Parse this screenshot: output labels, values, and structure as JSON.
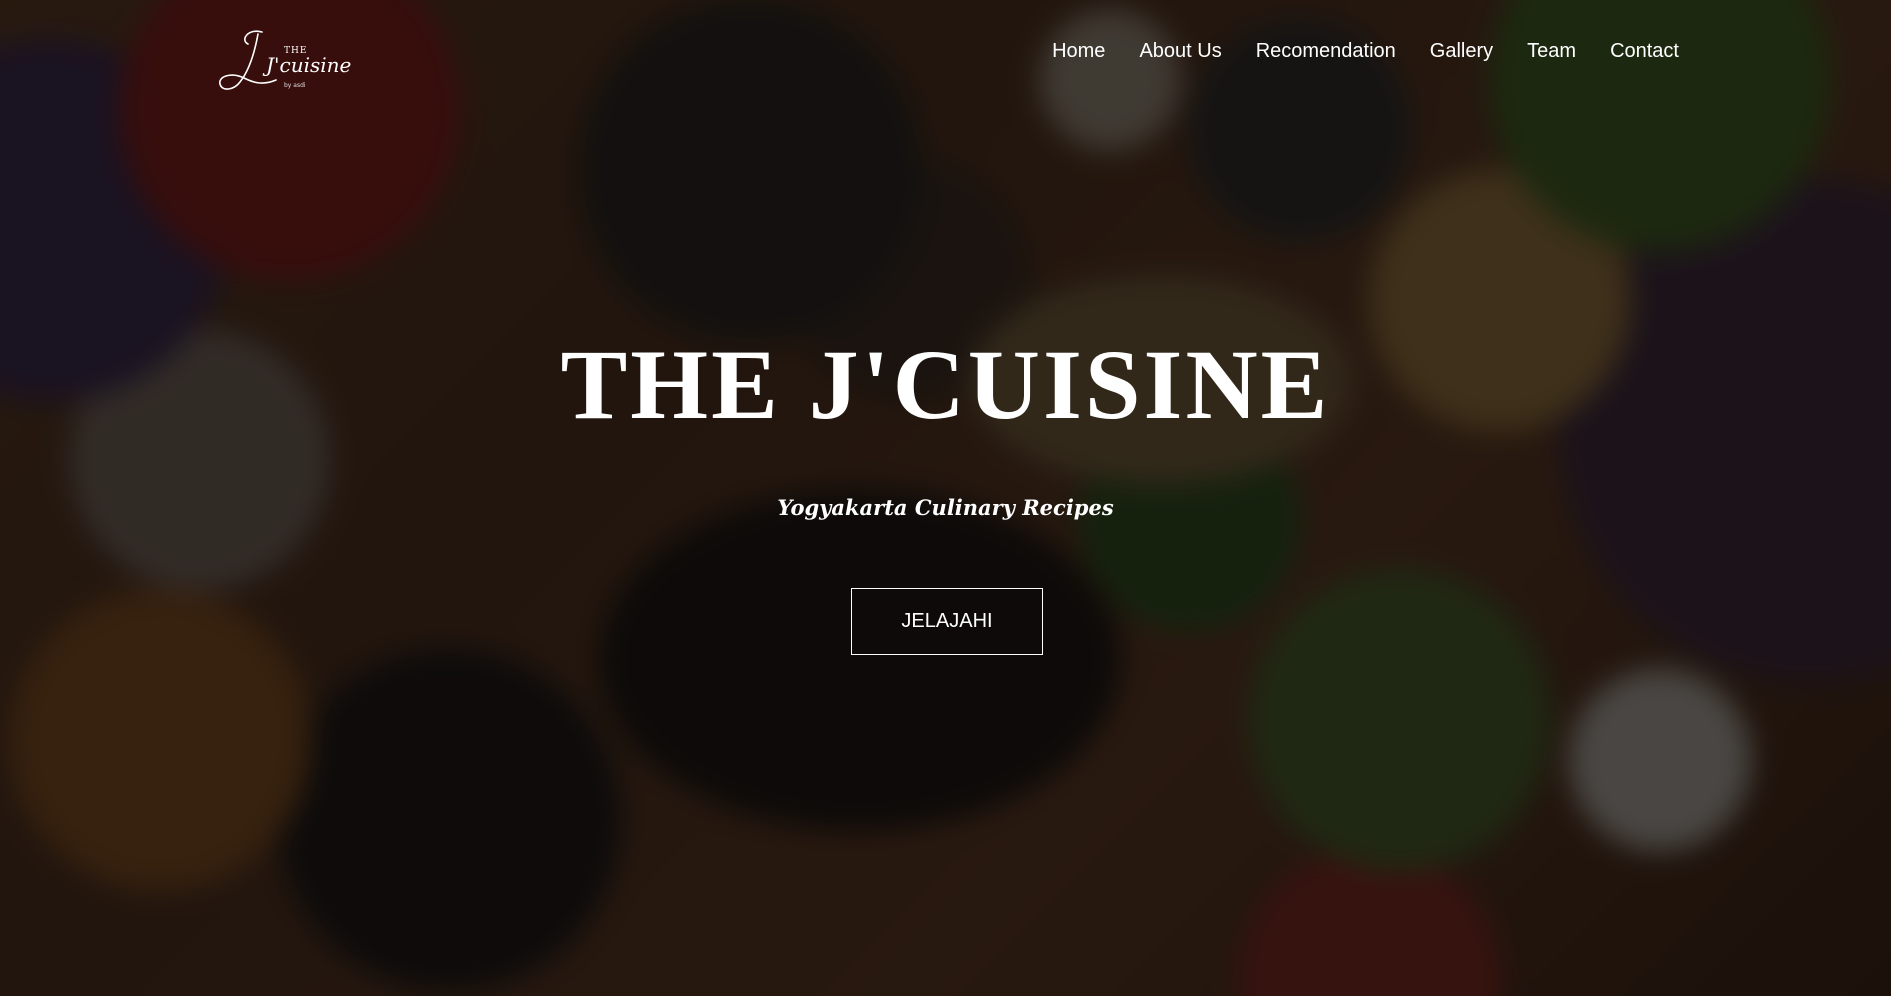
{
  "header": {
    "logo": {
      "the": "THE",
      "wordmark": "J'cuisine",
      "byline": "by asdi"
    },
    "nav": [
      {
        "label": "Home"
      },
      {
        "label": "About Us"
      },
      {
        "label": "Recomendation"
      },
      {
        "label": "Gallery"
      },
      {
        "label": "Team"
      },
      {
        "label": "Contact"
      }
    ]
  },
  "hero": {
    "title": "THE J'CUISINE",
    "subtitle": "Yogyakarta Culinary Recipes",
    "cta_label": "JELAJAHI",
    "background": "blurred overhead photo of a Yogyakarta food spread",
    "overlay_color": "#000000"
  },
  "colors": {
    "text": "#ffffff",
    "button_border": "#ffffff"
  }
}
